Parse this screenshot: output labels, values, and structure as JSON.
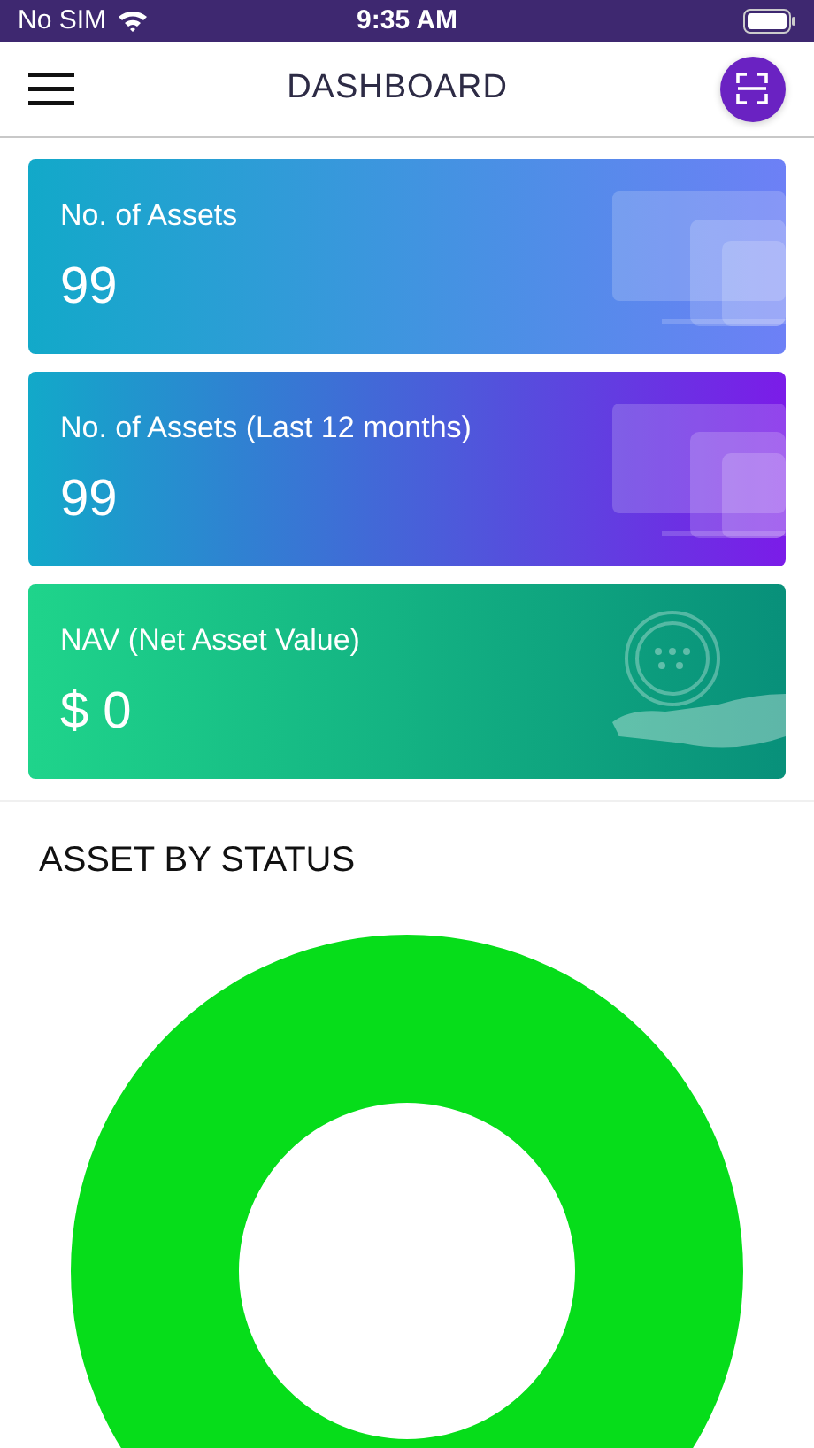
{
  "status_bar": {
    "carrier": "No SIM",
    "time": "9:35 AM"
  },
  "header": {
    "title": "DASHBOARD"
  },
  "cards": [
    {
      "label": "No. of Assets",
      "value": "99",
      "kind": "devices",
      "color": "#6d80f6"
    },
    {
      "label": "No. of Assets (Last 12 months)",
      "value": "99",
      "kind": "devices",
      "color": "#7b1ce8"
    },
    {
      "label": "NAV (Net Asset Value)",
      "value": "$ 0",
      "kind": "money",
      "color": "#08907a"
    }
  ],
  "section": {
    "title": "ASSET BY STATUS"
  }
}
